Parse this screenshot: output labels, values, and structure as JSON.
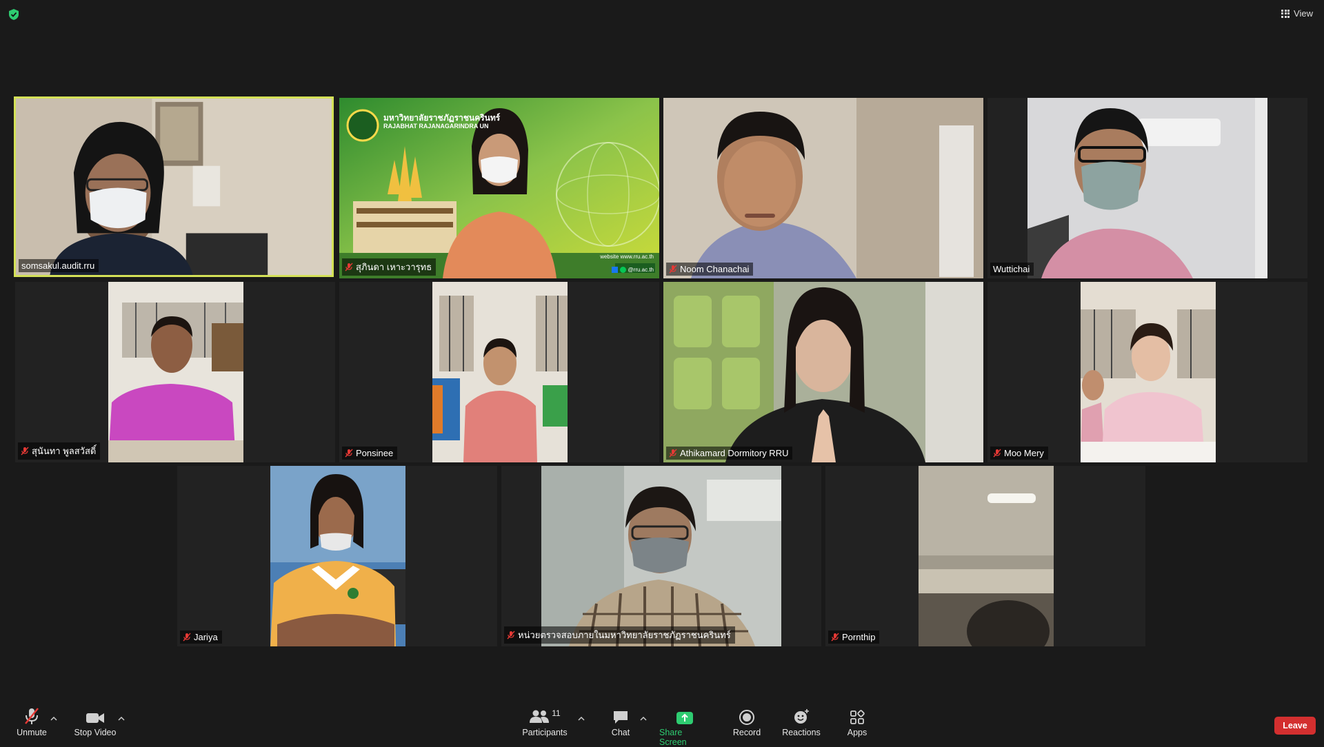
{
  "top": {
    "view_label": "View"
  },
  "tiles": [
    {
      "name": "somsakul.audit.rru",
      "muted": false
    },
    {
      "name": "สุภินดา เหาะวารุทธ",
      "muted": true,
      "banner_th": "มหาวิทยาลัยราชภัฏราชนครินทร์",
      "banner_en": "RAJABHAT RAJANAGARINDRA UN",
      "website": "website  www.rru.ac.th",
      "social": "@rru.ac.th"
    },
    {
      "name": "Noom Chanachai",
      "muted": true
    },
    {
      "name": "Wuttichai",
      "muted": false
    },
    {
      "name": "สุนันทา พูลสวัสดิ์",
      "muted": true
    },
    {
      "name": "Ponsinee",
      "muted": true
    },
    {
      "name": "Athikamard Dormitory RRU",
      "muted": true
    },
    {
      "name": "Moo Mery",
      "muted": true
    },
    {
      "name": "Jariya",
      "muted": true
    },
    {
      "name": "หน่วยตรวจสอบภายในมหาวิทยาลัยราชภัฏราชนครินทร์",
      "muted": true
    },
    {
      "name": "Pornthip",
      "muted": true
    }
  ],
  "toolbar": {
    "unmute": "Unmute",
    "stop_video": "Stop Video",
    "participants": "Participants",
    "participants_count": "11",
    "chat": "Chat",
    "share_screen": "Share Screen",
    "record": "Record",
    "reactions": "Reactions",
    "apps": "Apps",
    "leave": "Leave"
  },
  "colors": {
    "active_border": "#d4e157",
    "share_green": "#2ecc71",
    "leave_red": "#d32f2f"
  }
}
